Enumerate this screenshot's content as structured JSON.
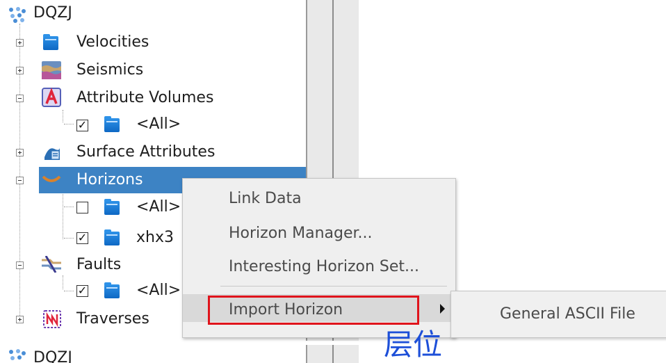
{
  "tree": {
    "root_label": "DQZJ",
    "items": [
      {
        "label": "Velocities"
      },
      {
        "label": "Seismics"
      },
      {
        "label": "Attribute Volumes"
      },
      {
        "label": "<All>"
      },
      {
        "label": "Surface Attributes"
      },
      {
        "label": "Horizons"
      },
      {
        "label": "<All>"
      },
      {
        "label": "xhx3"
      },
      {
        "label": "Faults"
      },
      {
        "label": "<All>"
      },
      {
        "label": "Traverses"
      }
    ],
    "selected": "Horizons"
  },
  "context_menu": {
    "items": [
      {
        "label": "Link Data"
      },
      {
        "label": "Horizon Manager..."
      },
      {
        "label": "Interesting Horizon Set..."
      },
      {
        "label": "Import Horizon"
      }
    ],
    "highlighted": "Import Horizon"
  },
  "submenu": {
    "items": [
      {
        "label": "General ASCII File"
      }
    ]
  },
  "duplicate_header": {
    "root_label": "DQZJ"
  },
  "caption": {
    "text": "层位"
  },
  "colors": {
    "selection": "#3d83c4",
    "highlight_box": "#e0141c",
    "caption": "#1d4fd8",
    "folder": "#1a7ad6"
  }
}
